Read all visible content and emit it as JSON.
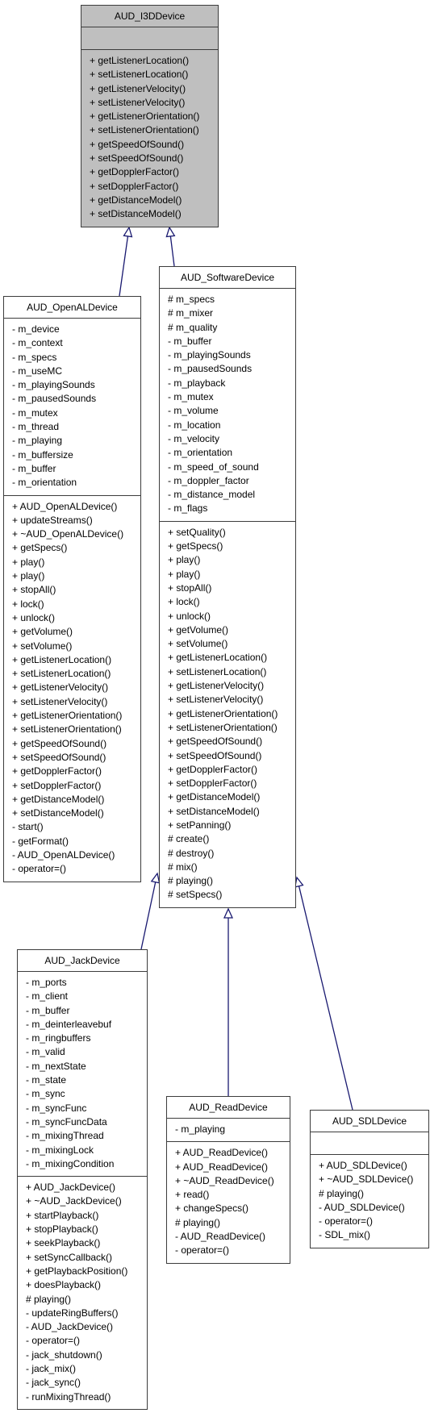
{
  "colors": {
    "edge": "#191970",
    "base_fill": "#bfbfbf",
    "box_fill": "#ffffff"
  },
  "classes": {
    "i3d": {
      "name": "AUD_I3DDevice",
      "attributes": [],
      "methods": [
        "+ getListenerLocation()",
        "+ setListenerLocation()",
        "+ getListenerVelocity()",
        "+ setListenerVelocity()",
        "+ getListenerOrientation()",
        "+ setListenerOrientation()",
        "+ getSpeedOfSound()",
        "+ setSpeedOfSound()",
        "+ getDopplerFactor()",
        "+ setDopplerFactor()",
        "+ getDistanceModel()",
        "+ setDistanceModel()"
      ]
    },
    "openal": {
      "name": "AUD_OpenALDevice",
      "attributes": [
        "- m_device",
        "- m_context",
        "- m_specs",
        "- m_useMC",
        "- m_playingSounds",
        "- m_pausedSounds",
        "- m_mutex",
        "- m_thread",
        "- m_playing",
        "- m_buffersize",
        "- m_buffer",
        "- m_orientation"
      ],
      "methods": [
        "+ AUD_OpenALDevice()",
        "+ updateStreams()",
        "+ ~AUD_OpenALDevice()",
        "+ getSpecs()",
        "+ play()",
        "+ play()",
        "+ stopAll()",
        "+ lock()",
        "+ unlock()",
        "+ getVolume()",
        "+ setVolume()",
        "+ getListenerLocation()",
        "+ setListenerLocation()",
        "+ getListenerVelocity()",
        "+ setListenerVelocity()",
        "+ getListenerOrientation()",
        "+ setListenerOrientation()",
        "+ getSpeedOfSound()",
        "+ setSpeedOfSound()",
        "+ getDopplerFactor()",
        "+ setDopplerFactor()",
        "+ getDistanceModel()",
        "+ setDistanceModel()",
        "- start()",
        "- getFormat()",
        "- AUD_OpenALDevice()",
        "- operator=()"
      ]
    },
    "software": {
      "name": "AUD_SoftwareDevice",
      "attributes": [
        "# m_specs",
        "# m_mixer",
        "# m_quality",
        "- m_buffer",
        "- m_playingSounds",
        "- m_pausedSounds",
        "- m_playback",
        "- m_mutex",
        "- m_volume",
        "- m_location",
        "- m_velocity",
        "- m_orientation",
        "- m_speed_of_sound",
        "- m_doppler_factor",
        "- m_distance_model",
        "- m_flags"
      ],
      "methods": [
        "+ setQuality()",
        "+ getSpecs()",
        "+ play()",
        "+ play()",
        "+ stopAll()",
        "+ lock()",
        "+ unlock()",
        "+ getVolume()",
        "+ setVolume()",
        "+ getListenerLocation()",
        "+ setListenerLocation()",
        "+ getListenerVelocity()",
        "+ setListenerVelocity()",
        "+ getListenerOrientation()",
        "+ setListenerOrientation()",
        "+ getSpeedOfSound()",
        "+ setSpeedOfSound()",
        "+ getDopplerFactor()",
        "+ setDopplerFactor()",
        "+ getDistanceModel()",
        "+ setDistanceModel()",
        "+ setPanning()",
        "# create()",
        "# destroy()",
        "# mix()",
        "# playing()",
        "# setSpecs()"
      ]
    },
    "jack": {
      "name": "AUD_JackDevice",
      "attributes": [
        "- m_ports",
        "- m_client",
        "- m_buffer",
        "- m_deinterleavebuf",
        "- m_ringbuffers",
        "- m_valid",
        "- m_nextState",
        "- m_state",
        "- m_sync",
        "- m_syncFunc",
        "- m_syncFuncData",
        "- m_mixingThread",
        "- m_mixingLock",
        "- m_mixingCondition"
      ],
      "methods": [
        "+ AUD_JackDevice()",
        "+ ~AUD_JackDevice()",
        "+ startPlayback()",
        "+ stopPlayback()",
        "+ seekPlayback()",
        "+ setSyncCallback()",
        "+ getPlaybackPosition()",
        "+ doesPlayback()",
        "# playing()",
        "- updateRingBuffers()",
        "- AUD_JackDevice()",
        "- operator=()",
        "- jack_shutdown()",
        "- jack_mix()",
        "- jack_sync()",
        "- runMixingThread()"
      ]
    },
    "read": {
      "name": "AUD_ReadDevice",
      "attributes": [
        "- m_playing"
      ],
      "methods": [
        "+ AUD_ReadDevice()",
        "+ AUD_ReadDevice()",
        "+ ~AUD_ReadDevice()",
        "+ read()",
        "+ changeSpecs()",
        "# playing()",
        "- AUD_ReadDevice()",
        "- operator=()"
      ]
    },
    "sdl": {
      "name": "AUD_SDLDevice",
      "attributes": [],
      "methods": [
        "+ AUD_SDLDevice()",
        "+ ~AUD_SDLDevice()",
        "# playing()",
        "- AUD_SDLDevice()",
        "- operator=()",
        "- SDL_mix()"
      ]
    }
  },
  "inheritance": [
    {
      "child": "AUD_OpenALDevice",
      "parent": "AUD_I3DDevice"
    },
    {
      "child": "AUD_SoftwareDevice",
      "parent": "AUD_I3DDevice"
    },
    {
      "child": "AUD_JackDevice",
      "parent": "AUD_SoftwareDevice"
    },
    {
      "child": "AUD_ReadDevice",
      "parent": "AUD_SoftwareDevice"
    },
    {
      "child": "AUD_SDLDevice",
      "parent": "AUD_SoftwareDevice"
    }
  ]
}
